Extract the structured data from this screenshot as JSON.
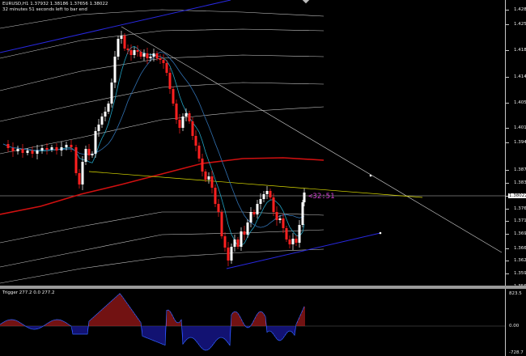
{
  "chart_header": {
    "symbol_line": "EURUSD,H1  1.37932 1.38186 1.37656 1.38022",
    "bar_timer_line": "32 minutes 51 seconds left to bar end"
  },
  "timer_label": "<32:51",
  "price_axis": {
    "labels": [
      "1.42870",
      "1.42520",
      "1.41860",
      "1.41460",
      "1.40530",
      "1.40130",
      "1.39400",
      "1.38700",
      "1.38370",
      "1.38022",
      "1.37680",
      "1.37130",
      "1.36990",
      "1.36640",
      "1.36200",
      "1.35950",
      "1.35610"
    ],
    "current": "1.38022"
  },
  "indicator": {
    "header": "Trigger 277.2 0.0 277.2",
    "axis_labels": [
      "823.5",
      "0.00",
      "-728.7"
    ]
  },
  "colors": {
    "background": "#000000",
    "bull_candle": "#ffffff",
    "bear_candle": "#ff2020",
    "ma_long": "#d01010",
    "channel_blue": "#2828e0",
    "trend_yellow": "#e0e000",
    "envelope": "#c8c8c8",
    "cyan_ma": "#20a0c0",
    "timer": "#d040d0",
    "hist_pos": "#d02020",
    "hist_neg": "#2020d0"
  }
}
